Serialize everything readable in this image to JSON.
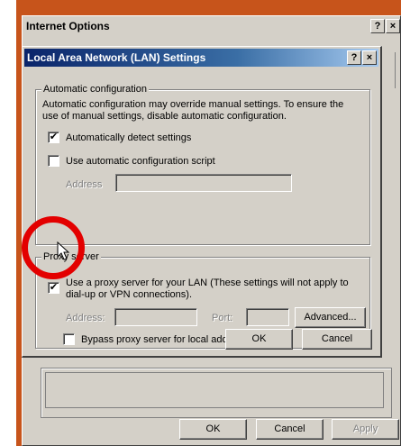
{
  "io_dialog": {
    "title": "Internet Options",
    "help_glyph": "?",
    "close_glyph": "×",
    "ok_label": "OK",
    "cancel_label": "Cancel",
    "apply_label": "Apply"
  },
  "lan_dialog": {
    "title": "Local Area Network (LAN) Settings",
    "help_glyph": "?",
    "close_glyph": "×",
    "auto_config": {
      "group_label": "Automatic configuration",
      "description_line1": "Automatic configuration may override manual settings.  To ensure the",
      "description_line2": "use of manual settings, disable automatic configuration.",
      "auto_detect_label": "Automatically detect settings",
      "auto_detect_checked": true,
      "script_label": "Use automatic configuration script",
      "script_checked": false,
      "address_label": "Address",
      "address_value": ""
    },
    "proxy": {
      "group_label": "Proxy server",
      "use_proxy_line1": "Use a proxy server for your LAN (These settings will not apply to",
      "use_proxy_line2": "dial-up or VPN connections).",
      "use_proxy_checked": true,
      "address_label": "Address:",
      "address_value": "",
      "port_label": "Port:",
      "port_value": "",
      "advanced_label": "Advanced...",
      "bypass_label": "Bypass proxy server for local addresses",
      "bypass_checked": false
    },
    "ok_label": "OK",
    "cancel_label": "Cancel"
  },
  "colors": {
    "backdrop": "#c7541b",
    "title_active": "#0a246a",
    "highlight": "#e30000"
  },
  "icons": {
    "check": "✔",
    "cursor": "arrow-cursor-icon"
  }
}
